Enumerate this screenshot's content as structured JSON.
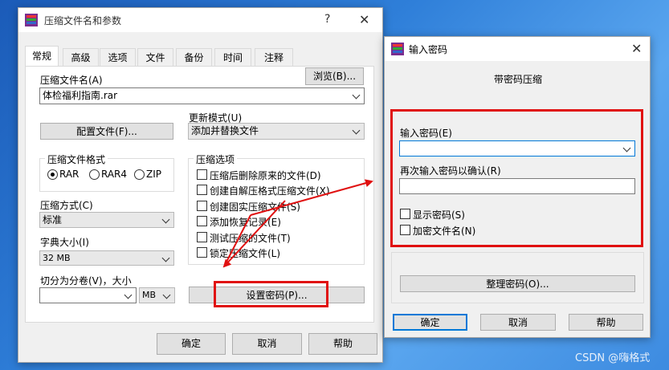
{
  "main_dialog": {
    "title": "压缩文件名和参数",
    "help_icon": "?",
    "close_icon": "✕",
    "tabs": [
      {
        "label": "常规"
      },
      {
        "label": "高级"
      },
      {
        "label": "选项"
      },
      {
        "label": "文件"
      },
      {
        "label": "备份"
      },
      {
        "label": "时间"
      },
      {
        "label": "注释"
      }
    ],
    "archive_name_label": "压缩文件名(A)",
    "browse_button": "浏览(B)...",
    "archive_name_value": "体检福利指南.rar",
    "profiles_button": "配置文件(F)...",
    "update_mode_label": "更新模式(U)",
    "update_mode_value": "添加并替换文件",
    "format_group_title": "压缩文件格式",
    "format_options": [
      "RAR",
      "RAR4",
      "ZIP"
    ],
    "options_group_title": "压缩选项",
    "options": [
      "压缩后删除原来的文件(D)",
      "创建自解压格式压缩文件(X)",
      "创建固实压缩文件(S)",
      "添加恢复记录(E)",
      "测试压缩的文件(T)",
      "锁定压缩文件(L)"
    ],
    "method_label": "压缩方式(C)",
    "method_value": "标准",
    "dict_label": "字典大小(I)",
    "dict_value": "32 MB",
    "split_label": "切分为分卷(V)，大小",
    "split_value": "",
    "split_unit": "MB",
    "set_password_button": "设置密码(P)...",
    "ok_button": "确定",
    "cancel_button": "取消",
    "help_button": "帮助"
  },
  "password_dialog": {
    "title": "输入密码",
    "close_icon": "✕",
    "heading": "带密码压缩",
    "enter_label": "输入密码(E)",
    "enter_value": "",
    "reenter_label": "再次输入密码以确认(R)",
    "reenter_value": "",
    "show_password_label": "显示密码(S)",
    "encrypt_names_label": "加密文件名(N)",
    "organize_button": "整理密码(O)...",
    "ok_button": "确定",
    "cancel_button": "取消",
    "help_button": "帮助"
  },
  "watermark": "CSDN @嗨格式",
  "colors": {
    "annotation_red": "#e01010",
    "focus_blue": "#0078d7",
    "dialog_bg": "#f0f0f0"
  }
}
